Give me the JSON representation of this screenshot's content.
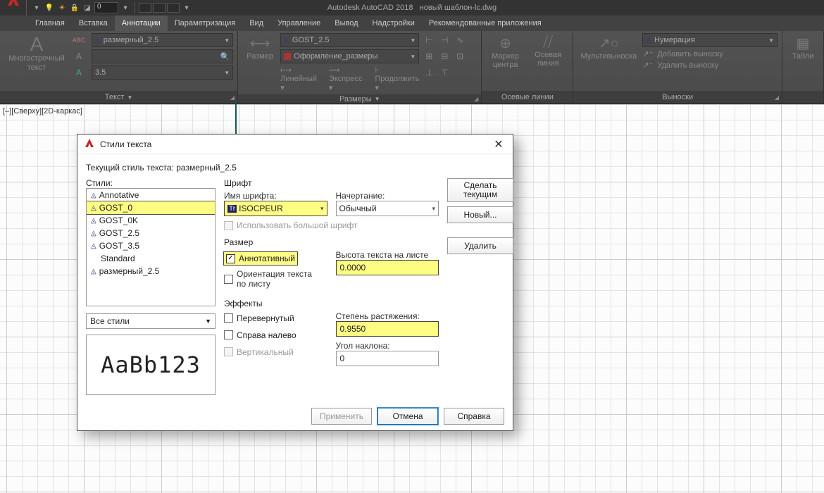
{
  "app": {
    "name": "Autodesk AutoCAD 2018",
    "doc": "новый шаблон-lc.dwg"
  },
  "qat": {
    "layer_value": "0"
  },
  "tabs": [
    "Главная",
    "Вставка",
    "Аннотации",
    "Параметризация",
    "Вид",
    "Управление",
    "Вывод",
    "Надстройки",
    "Рекомендованные приложения"
  ],
  "active_tab": "Аннотации",
  "ribbon": {
    "text_panel": {
      "title": "Текст",
      "big_label": "Многострочный текст",
      "style_select": "размерный_2.5",
      "size_select": "3.5"
    },
    "dim_panel": {
      "title": "Размеры",
      "big_label": "Размер",
      "style_select": "GOST_2.5",
      "layer_select": "Оформление_размеры",
      "row3": [
        "Линейный",
        "Экспресс",
        "Продолжить"
      ]
    },
    "axes_panel": {
      "title": "Осевые линии",
      "btn1": "Маркер центра",
      "btn2": "Осевая линия"
    },
    "leader_panel": {
      "title": "Выноски",
      "big_label": "Мультивыноска",
      "style_select": "Нумерация",
      "opt1": "Добавить выноску",
      "opt2": "Удалить выноску"
    },
    "table_panel": {
      "big_label": "Табли"
    }
  },
  "viewport_label": "[–][Сверху][2D-каркас]",
  "dialog": {
    "title": "Стили текста",
    "current_label": "Текущий стиль текста:",
    "current_value": "размерный_2.5",
    "styles_label": "Стили:",
    "styles": [
      "Annotative",
      "GOST_0",
      "GOST_0K",
      "GOST_2.5",
      "GOST_3.5",
      "Standard",
      "размерный_2.5"
    ],
    "selected_style": "GOST_0",
    "filter": "Все стили",
    "preview": "AaBb123",
    "font_group": "Шрифт",
    "font_name_label": "Имя шрифта:",
    "font_name": "ISOCPEUR",
    "font_style_label": "Начертание:",
    "font_style": "Обычный",
    "bigfont_label": "Использовать большой шрифт",
    "size_group": "Размер",
    "annotative_label": "Аннотативный",
    "orient_label": "Ориентация текста по листу",
    "height_label": "Высота текста на листе",
    "height_value": "0.0000",
    "effects_group": "Эффекты",
    "upside_label": "Перевернутый",
    "backwards_label": "Справа налево",
    "vertical_label": "Вертикальный",
    "width_label": "Степень растяжения:",
    "width_value": "0.9550",
    "oblique_label": "Угол наклона:",
    "oblique_value": "0",
    "set_current": "Сделать текущим",
    "new_btn": "Новый...",
    "delete_btn": "Удалить",
    "apply_btn": "Применить",
    "cancel_btn": "Отмена",
    "help_btn": "Справка"
  }
}
